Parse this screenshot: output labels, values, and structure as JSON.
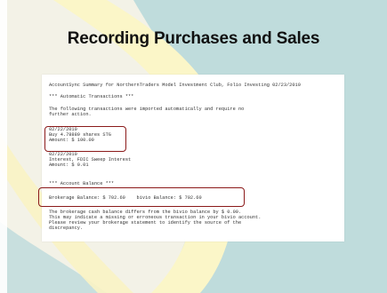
{
  "slide": {
    "title": "Recording Purchases and Sales"
  },
  "document": {
    "header_line": "AccountSync Summary for NorthernTraders Model Investment Club, Folio Investing 02/23/2010",
    "section_auto": "*** Automatic Transactions ***",
    "intro_line1": "The following transactions were imported automatically and require no",
    "intro_line2": "further action.",
    "tx1_date": "02/22/2010",
    "tx1_desc": "Buy 4.78889 shares STG",
    "tx1_amount": "Amount: $ 100.00",
    "tx2_date": "02/22/2010",
    "tx2_desc": "Interest, FDIC Sweep Interest",
    "tx2_amount": "Amount: $ 0.01",
    "section_balance": "*** Account Balance ***",
    "balance_line": "Brokerage Balance: $ 702.60    bivio Balance: $ 702.60",
    "note_line1": "The brokerage cash balance differs from the bivio balance by $ 0.00.",
    "note_line2": "This may indicate a missing or erroneous transaction in your bivio account.",
    "note_line3": "Please review your brokerage statement to identify the source of the",
    "note_line4": "discrepancy."
  },
  "colors": {
    "slide_background": "#f3f2e7",
    "teal_shape": "#bfdcdc",
    "cream_swoosh": "#fbf6c8",
    "highlight_border": "#8b1a1a",
    "title_text": "#111111"
  }
}
